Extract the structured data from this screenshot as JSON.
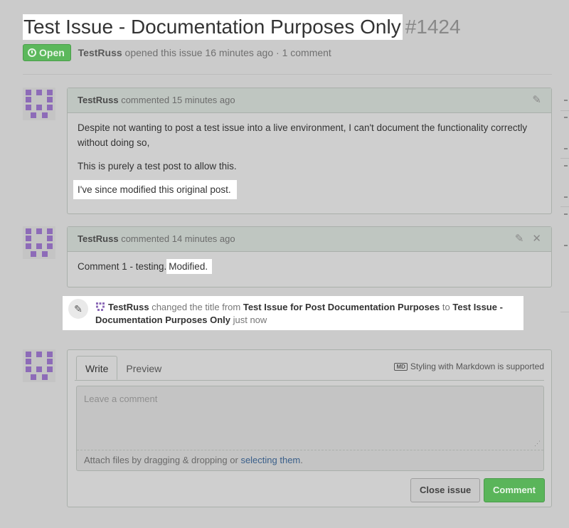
{
  "issue": {
    "title": "Test Issue - Documentation Purposes Only",
    "number": "#1424",
    "state": "Open",
    "author": "TestRuss",
    "opened_text": "opened this issue 16 minutes ago · 1 comment"
  },
  "comments": [
    {
      "author": "TestRuss",
      "meta": "commented 15 minutes ago",
      "paragraphs": [
        "Despite not wanting to post a test issue into a live environment, I can't document the functionality correctly without doing so,",
        "This is purely a test post to allow this.",
        "I've since modified this original post."
      ]
    },
    {
      "author": "TestRuss",
      "meta": "commented 14 minutes ago",
      "text": "Comment 1 - testing.",
      "modified": "Modified."
    }
  ],
  "event": {
    "actor": "TestRuss",
    "action": "changed the title from",
    "old_title": "Test Issue for Post Documentation Purposes",
    "to": "to",
    "new_title": "Test Issue - Documentation Purposes Only",
    "time": "just now"
  },
  "compose": {
    "tab_write": "Write",
    "tab_preview": "Preview",
    "markdown_badge": "MD",
    "markdown_note": "Styling with Markdown is supported",
    "placeholder": "Leave a comment",
    "attach_text": "Attach files by dragging & dropping or",
    "attach_link": "selecting them",
    "attach_end": ".",
    "close_button": "Close issue",
    "comment_button": "Comment"
  },
  "colors": {
    "open_badge": "#5cb85c",
    "comment_button": "#5ab55a",
    "avatar": "#8d6bb8",
    "link": "#3a5f8a"
  }
}
